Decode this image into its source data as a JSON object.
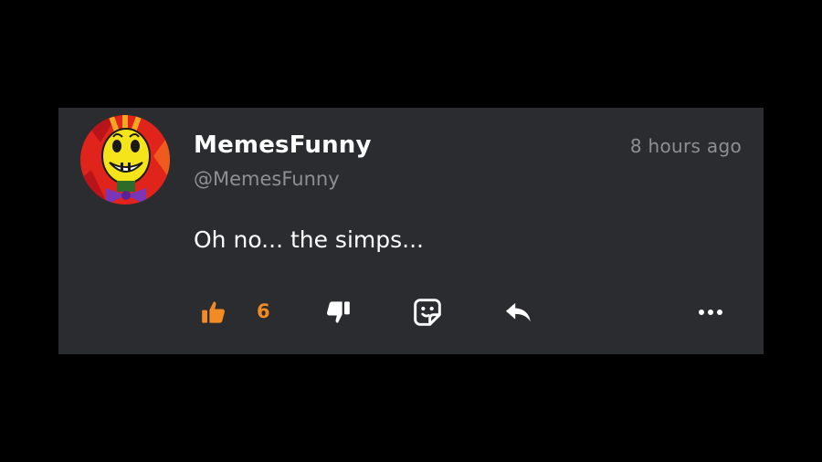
{
  "post": {
    "username": "MemesFunny",
    "handle": "@MemesFunny",
    "timestamp": "8 hours ago",
    "text": "Oh no... the simps...",
    "avatar_icon": "clown-avatar",
    "likes": "6"
  },
  "actions": {
    "like_icon": "thumbs-up-icon",
    "dislike_icon": "thumbs-down-icon",
    "sticker_icon": "sticker-icon",
    "reply_icon": "reply-icon",
    "more_icon": "more-icon"
  },
  "colors": {
    "background": "#000000",
    "card": "#2b2c2f",
    "text": "#ffffff",
    "muted": "#8e8f93",
    "accent": "#f28b23"
  }
}
